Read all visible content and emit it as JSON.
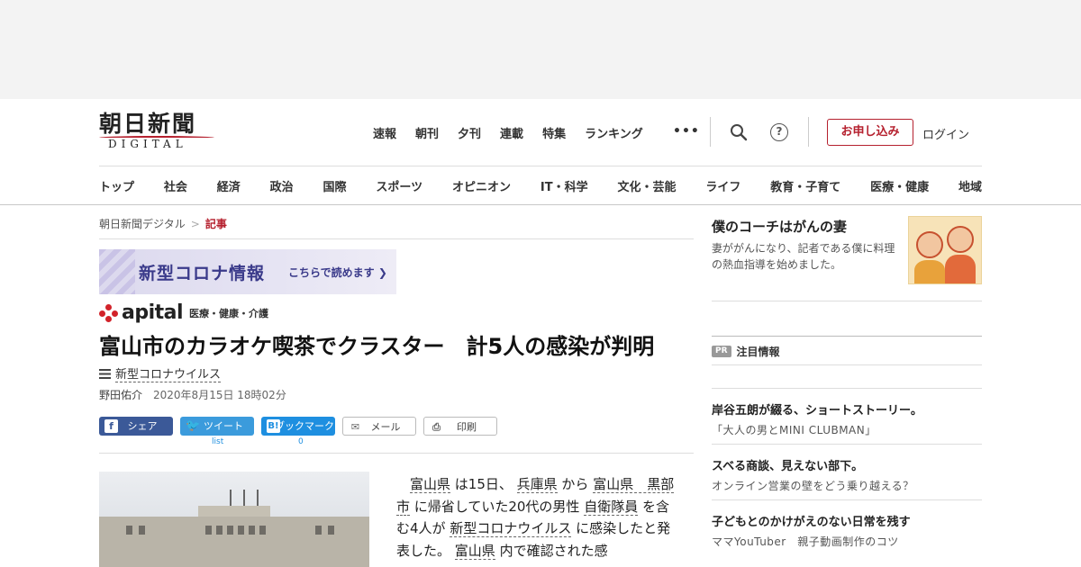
{
  "header": {
    "logo_text": "朝日新聞",
    "logo_sub": "DIGITAL",
    "top_nav": [
      "速報",
      "朝刊",
      "夕刊",
      "連載",
      "特集",
      "ランキング"
    ],
    "more": "•••",
    "subscribe_label": "お申し込み",
    "login_label": "ログイン",
    "help_glyph": "?"
  },
  "categories": [
    "トップ",
    "社会",
    "経済",
    "政治",
    "国際",
    "スポーツ",
    "オピニオン",
    "IT・科学",
    "文化・芸能",
    "ライフ",
    "教育・子育て",
    "医療・健康",
    "地域"
  ],
  "breadcrumb": {
    "home": "朝日新聞デジタル",
    "sep": ">",
    "current": "記事"
  },
  "corona_banner": {
    "title": "新型コロナ情報",
    "cta": "こちらで読めます ❯"
  },
  "apital": {
    "brand": "apital",
    "sub": "医療・健康・介護"
  },
  "article": {
    "headline": "富山市のカラオケ喫茶でクラスター　計5人の感染が判明",
    "topic": "新型コロナウイルス",
    "author": "野田佑介",
    "date": "2020年8月15日 18時02分",
    "body": {
      "p1": "富山県",
      "p2": " は15日、 ",
      "p3": "兵庫県",
      "p4": " から ",
      "p5": "富山県　黒部市",
      "p6": " に帰省していた20代の男性 ",
      "p7": "自衛隊員",
      "p8": " を含む4人が ",
      "p9": "新型コロナウイルス",
      "p10": " に感染したと発表した。 ",
      "p11": "富山県",
      "p12": " 内で確認された感"
    }
  },
  "share": {
    "facebook": {
      "icon": "f",
      "label": "シェア"
    },
    "twitter": {
      "icon": "🐦",
      "label": "ツイート",
      "count": "list"
    },
    "hatena": {
      "icon": "B!",
      "label": "ブックマーク",
      "count": "0"
    },
    "mail": {
      "icon": "✉",
      "label": "メール"
    },
    "print": {
      "icon": "⎙",
      "label": "印刷"
    }
  },
  "sidebar": {
    "promo": {
      "title": "僕のコーチはがんの妻",
      "desc": "妻ががんになり、記者である僕に料理の熱血指導を始めました。"
    },
    "pr_badge": "PR",
    "pr_label": "注目情報",
    "pr_items": [
      {
        "title": "岸谷五朗が綴る、ショートストーリー。",
        "sub": "「大人の男とMINI CLUBMAN」"
      },
      {
        "title": "スベる商談、見えない部下。",
        "sub": "オンライン営業の壁をどう乗り越える？"
      },
      {
        "title": "子どもとのかけがえのない日常を残す",
        "sub": "ママYouTuber　親子動画制作のコツ"
      }
    ]
  }
}
